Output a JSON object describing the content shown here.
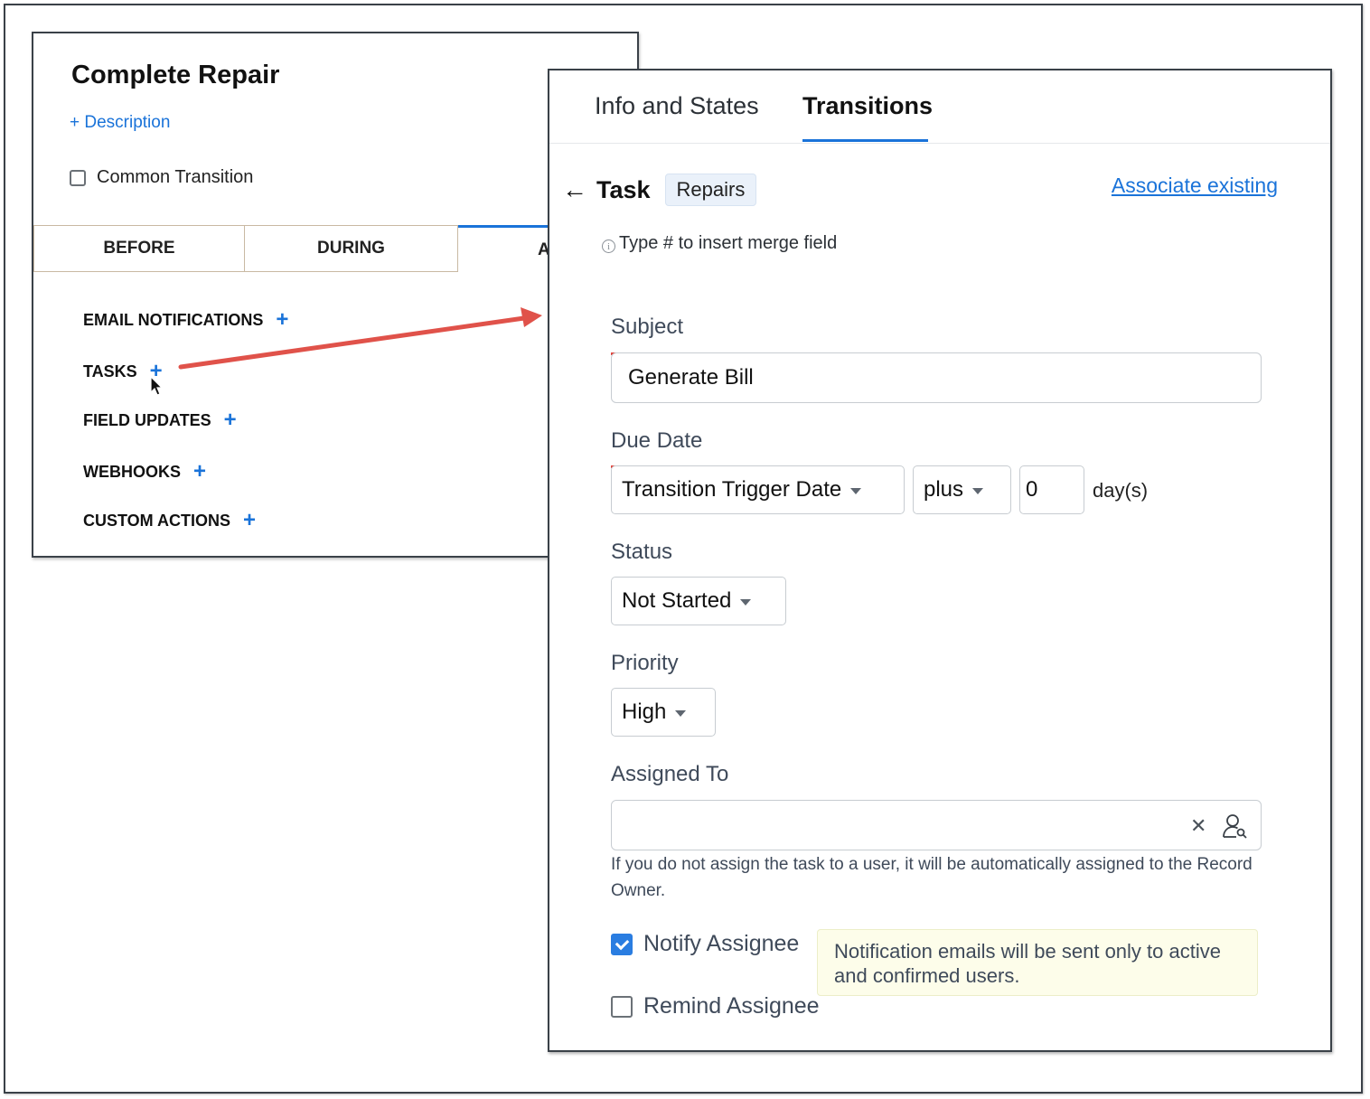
{
  "left_panel": {
    "title": "Complete Repair",
    "description_link": "+ Description",
    "common_transition_label": "Common Transition",
    "tabs": [
      {
        "label": "BEFORE"
      },
      {
        "label": "DURING"
      },
      {
        "label": "A"
      }
    ],
    "sections": [
      {
        "label": "EMAIL NOTIFICATIONS",
        "icon": "plus-icon"
      },
      {
        "label": "TASKS",
        "icon": "plus-icon"
      },
      {
        "label": "FIELD UPDATES",
        "icon": "plus-icon"
      },
      {
        "label": "WEBHOOKS",
        "icon": "plus-icon"
      },
      {
        "label": "CUSTOM ACTIONS",
        "icon": "plus-icon"
      }
    ],
    "plus_glyph": "+"
  },
  "right_panel": {
    "tabs": [
      {
        "label": "Info and States",
        "active": false
      },
      {
        "label": "Transitions",
        "active": true
      }
    ],
    "back_glyph": "←",
    "header_title": "Task",
    "module_badge": "Repairs",
    "associate_link": "Associate existing",
    "merge_hint": "Type # to insert merge field",
    "info_glyph": "i",
    "subject": {
      "label": "Subject",
      "value": "Generate Bill"
    },
    "due_date": {
      "label": "Due Date",
      "base": "Transition Trigger Date",
      "operator": "plus",
      "offset": "0",
      "unit": "day(s)"
    },
    "status": {
      "label": "Status",
      "value": "Not Started"
    },
    "priority": {
      "label": "Priority",
      "value": "High"
    },
    "assigned_to": {
      "label": "Assigned To",
      "value": "",
      "clear_glyph": "✕",
      "helper": "If you do not assign the task to a user, it will be automatically assigned to the Record Owner."
    },
    "notify_assignee": {
      "label": "Notify Assignee",
      "checked": true
    },
    "notify_tooltip": "Notification emails will be sent only to active and confirmed users.",
    "remind_assignee": {
      "label": "Remind Assignee",
      "checked": false
    }
  },
  "colors": {
    "accent_blue": "#1a73d9",
    "required_red": "#e0433b",
    "arrow_red": "#e0524a",
    "tooltip_bg": "#fdfdea"
  }
}
